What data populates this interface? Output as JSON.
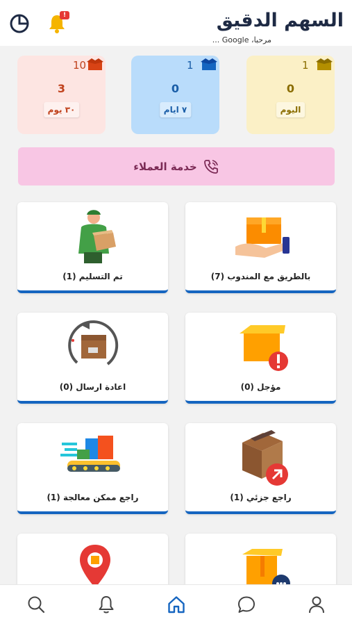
{
  "header": {
    "title": "السهم الدقيق",
    "subtitle": "مرحبا، Google ...",
    "notification_badge": "!"
  },
  "stats": {
    "month": {
      "count": "10",
      "value": "3",
      "label": "٣٠ يوم"
    },
    "week": {
      "count": "1",
      "value": "0",
      "label": "٧ ايام"
    },
    "today": {
      "count": "1",
      "value": "0",
      "label": "اليوم"
    }
  },
  "support": {
    "label": "خدمة العملاء"
  },
  "cards": {
    "delivered": {
      "label": "تم التسليم (1)"
    },
    "with_courier": {
      "label": "بالطريق مع المندوب (7)"
    },
    "resend": {
      "label": "اعادة ارسال (0)"
    },
    "postponed": {
      "label": "مؤجل (0)"
    },
    "returned_processable": {
      "label": "راجع ممكن معالجة (1)"
    },
    "partial_return": {
      "label": "راجع جزئي (1)"
    }
  },
  "colors": {
    "accent": "#1565c0",
    "support_bg": "#f8c6e4",
    "month_bg": "#fde5e2",
    "week_bg": "#b9dcfb",
    "today_bg": "#fbf0c6"
  },
  "nav": [
    "search-icon",
    "bell-icon",
    "home-icon",
    "chat-icon",
    "user-icon"
  ]
}
